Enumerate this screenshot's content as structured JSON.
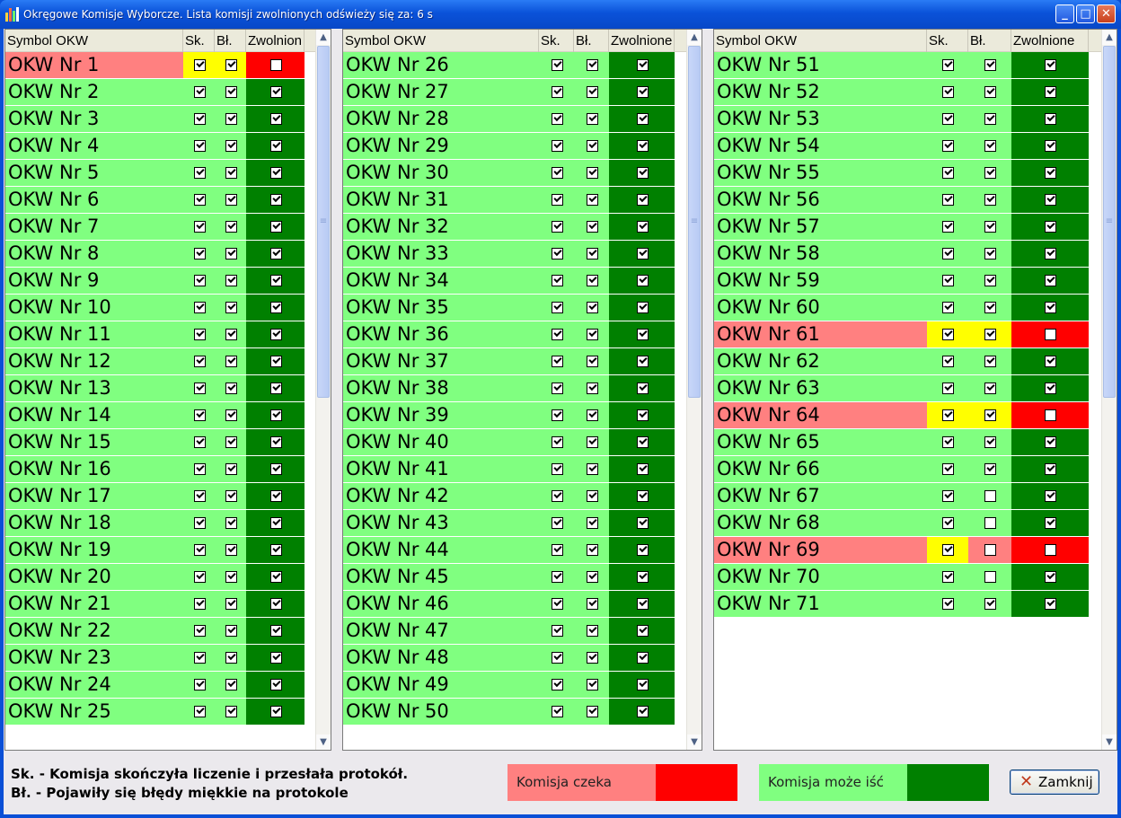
{
  "window": {
    "title": "Okręgowe Komisje Wyborcze. Lista komisji zwolnionych odświeży się za: 6 s"
  },
  "columns": {
    "symbol": "Symbol OKW",
    "sk": "Sk.",
    "bl": "Bł.",
    "zwolnione": "Zwolnione"
  },
  "panels": [
    {
      "header_zwolnione": "Zwolnion",
      "rows": [
        {
          "symbol": "OKW Nr 1",
          "sk": true,
          "bl": true,
          "zwolnione": false
        },
        {
          "symbol": "OKW Nr 2",
          "sk": true,
          "bl": true,
          "zwolnione": true
        },
        {
          "symbol": "OKW Nr 3",
          "sk": true,
          "bl": true,
          "zwolnione": true
        },
        {
          "symbol": "OKW Nr 4",
          "sk": true,
          "bl": true,
          "zwolnione": true
        },
        {
          "symbol": "OKW Nr 5",
          "sk": true,
          "bl": true,
          "zwolnione": true
        },
        {
          "symbol": "OKW Nr 6",
          "sk": true,
          "bl": true,
          "zwolnione": true
        },
        {
          "symbol": "OKW Nr 7",
          "sk": true,
          "bl": true,
          "zwolnione": true
        },
        {
          "symbol": "OKW Nr 8",
          "sk": true,
          "bl": true,
          "zwolnione": true
        },
        {
          "symbol": "OKW Nr 9",
          "sk": true,
          "bl": true,
          "zwolnione": true
        },
        {
          "symbol": "OKW Nr 10",
          "sk": true,
          "bl": true,
          "zwolnione": true
        },
        {
          "symbol": "OKW Nr 11",
          "sk": true,
          "bl": true,
          "zwolnione": true
        },
        {
          "symbol": "OKW Nr 12",
          "sk": true,
          "bl": true,
          "zwolnione": true
        },
        {
          "symbol": "OKW Nr 13",
          "sk": true,
          "bl": true,
          "zwolnione": true
        },
        {
          "symbol": "OKW Nr 14",
          "sk": true,
          "bl": true,
          "zwolnione": true
        },
        {
          "symbol": "OKW Nr 15",
          "sk": true,
          "bl": true,
          "zwolnione": true
        },
        {
          "symbol": "OKW Nr 16",
          "sk": true,
          "bl": true,
          "zwolnione": true
        },
        {
          "symbol": "OKW Nr 17",
          "sk": true,
          "bl": true,
          "zwolnione": true
        },
        {
          "symbol": "OKW Nr 18",
          "sk": true,
          "bl": true,
          "zwolnione": true
        },
        {
          "symbol": "OKW Nr 19",
          "sk": true,
          "bl": true,
          "zwolnione": true
        },
        {
          "symbol": "OKW Nr 20",
          "sk": true,
          "bl": true,
          "zwolnione": true
        },
        {
          "symbol": "OKW Nr 21",
          "sk": true,
          "bl": true,
          "zwolnione": true
        },
        {
          "symbol": "OKW Nr 22",
          "sk": true,
          "bl": true,
          "zwolnione": true
        },
        {
          "symbol": "OKW Nr 23",
          "sk": true,
          "bl": true,
          "zwolnione": true
        },
        {
          "symbol": "OKW Nr 24",
          "sk": true,
          "bl": true,
          "zwolnione": true
        },
        {
          "symbol": "OKW Nr 25",
          "sk": true,
          "bl": true,
          "zwolnione": true
        }
      ]
    },
    {
      "header_zwolnione": "Zwolnione",
      "rows": [
        {
          "symbol": "OKW Nr 26",
          "sk": true,
          "bl": true,
          "zwolnione": true
        },
        {
          "symbol": "OKW Nr 27",
          "sk": true,
          "bl": true,
          "zwolnione": true
        },
        {
          "symbol": "OKW Nr 28",
          "sk": true,
          "bl": true,
          "zwolnione": true
        },
        {
          "symbol": "OKW Nr 29",
          "sk": true,
          "bl": true,
          "zwolnione": true
        },
        {
          "symbol": "OKW Nr 30",
          "sk": true,
          "bl": true,
          "zwolnione": true
        },
        {
          "symbol": "OKW Nr 31",
          "sk": true,
          "bl": true,
          "zwolnione": true
        },
        {
          "symbol": "OKW Nr 32",
          "sk": true,
          "bl": true,
          "zwolnione": true
        },
        {
          "symbol": "OKW Nr 33",
          "sk": true,
          "bl": true,
          "zwolnione": true
        },
        {
          "symbol": "OKW Nr 34",
          "sk": true,
          "bl": true,
          "zwolnione": true
        },
        {
          "symbol": "OKW Nr 35",
          "sk": true,
          "bl": true,
          "zwolnione": true
        },
        {
          "symbol": "OKW Nr 36",
          "sk": true,
          "bl": true,
          "zwolnione": true
        },
        {
          "symbol": "OKW Nr 37",
          "sk": true,
          "bl": true,
          "zwolnione": true
        },
        {
          "symbol": "OKW Nr 38",
          "sk": true,
          "bl": true,
          "zwolnione": true
        },
        {
          "symbol": "OKW Nr 39",
          "sk": true,
          "bl": true,
          "zwolnione": true
        },
        {
          "symbol": "OKW Nr 40",
          "sk": true,
          "bl": true,
          "zwolnione": true
        },
        {
          "symbol": "OKW Nr 41",
          "sk": true,
          "bl": true,
          "zwolnione": true
        },
        {
          "symbol": "OKW Nr 42",
          "sk": true,
          "bl": true,
          "zwolnione": true
        },
        {
          "symbol": "OKW Nr 43",
          "sk": true,
          "bl": true,
          "zwolnione": true
        },
        {
          "symbol": "OKW Nr 44",
          "sk": true,
          "bl": true,
          "zwolnione": true
        },
        {
          "symbol": "OKW Nr 45",
          "sk": true,
          "bl": true,
          "zwolnione": true
        },
        {
          "symbol": "OKW Nr 46",
          "sk": true,
          "bl": true,
          "zwolnione": true
        },
        {
          "symbol": "OKW Nr 47",
          "sk": true,
          "bl": true,
          "zwolnione": true
        },
        {
          "symbol": "OKW Nr 48",
          "sk": true,
          "bl": true,
          "zwolnione": true
        },
        {
          "symbol": "OKW Nr 49",
          "sk": true,
          "bl": true,
          "zwolnione": true
        },
        {
          "symbol": "OKW Nr 50",
          "sk": true,
          "bl": true,
          "zwolnione": true
        }
      ]
    },
    {
      "header_zwolnione": "Zwolnione",
      "rows": [
        {
          "symbol": "OKW Nr 51",
          "sk": true,
          "bl": true,
          "zwolnione": true
        },
        {
          "symbol": "OKW Nr 52",
          "sk": true,
          "bl": true,
          "zwolnione": true
        },
        {
          "symbol": "OKW Nr 53",
          "sk": true,
          "bl": true,
          "zwolnione": true
        },
        {
          "symbol": "OKW Nr 54",
          "sk": true,
          "bl": true,
          "zwolnione": true
        },
        {
          "symbol": "OKW Nr 55",
          "sk": true,
          "bl": true,
          "zwolnione": true
        },
        {
          "symbol": "OKW Nr 56",
          "sk": true,
          "bl": true,
          "zwolnione": true
        },
        {
          "symbol": "OKW Nr 57",
          "sk": true,
          "bl": true,
          "zwolnione": true
        },
        {
          "symbol": "OKW Nr 58",
          "sk": true,
          "bl": true,
          "zwolnione": true
        },
        {
          "symbol": "OKW Nr 59",
          "sk": true,
          "bl": true,
          "zwolnione": true
        },
        {
          "symbol": "OKW Nr 60",
          "sk": true,
          "bl": true,
          "zwolnione": true
        },
        {
          "symbol": "OKW Nr 61",
          "sk": true,
          "bl": true,
          "zwolnione": false
        },
        {
          "symbol": "OKW Nr 62",
          "sk": true,
          "bl": true,
          "zwolnione": true
        },
        {
          "symbol": "OKW Nr 63",
          "sk": true,
          "bl": true,
          "zwolnione": true
        },
        {
          "symbol": "OKW Nr 64",
          "sk": true,
          "bl": true,
          "zwolnione": false
        },
        {
          "symbol": "OKW Nr 65",
          "sk": true,
          "bl": true,
          "zwolnione": true
        },
        {
          "symbol": "OKW Nr 66",
          "sk": true,
          "bl": true,
          "zwolnione": true
        },
        {
          "symbol": "OKW Nr 67",
          "sk": true,
          "bl": false,
          "zwolnione": true
        },
        {
          "symbol": "OKW Nr 68",
          "sk": true,
          "bl": false,
          "zwolnione": true
        },
        {
          "symbol": "OKW Nr 69",
          "sk": true,
          "bl": false,
          "zwolnione": false
        },
        {
          "symbol": "OKW Nr 70",
          "sk": true,
          "bl": false,
          "zwolnione": true
        },
        {
          "symbol": "OKW Nr 71",
          "sk": true,
          "bl": true,
          "zwolnione": true
        }
      ]
    }
  ],
  "legend": {
    "sk_line": "Sk. - Komisja skończyła liczenie i przesłała protokół.",
    "bl_line": "Bł. - Pojawiły się błędy miękkie na protokole",
    "waiting_label": "Komisja czeka",
    "can_go_label": "Komisja może iść"
  },
  "close_button": {
    "label": "Zamknij"
  },
  "colors": {
    "ok_row": "#80ff80",
    "ok_flag": "#008000",
    "wait_row": "#ff8080",
    "wait_flag": "#ff0000",
    "wait_check": "#ffff00"
  },
  "icons": {
    "app": "chart-bars-icon",
    "close": "x-icon",
    "minimize": "minimize-icon",
    "maximize": "maximize-icon",
    "window_close": "window-close-icon",
    "checkbox_checked": "checkbox-checked-icon",
    "checkbox_empty": "checkbox-empty-icon"
  }
}
